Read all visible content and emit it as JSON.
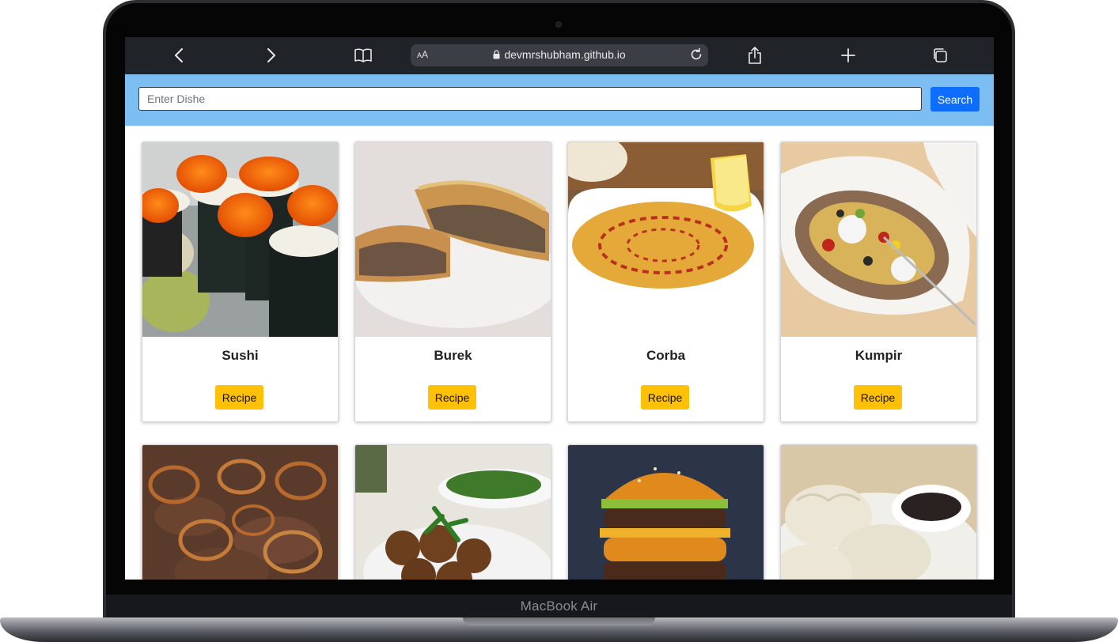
{
  "device": {
    "label": "MacBook Air"
  },
  "browser": {
    "url": "devmrshubham.github.io",
    "text_size_label": "AA"
  },
  "search": {
    "placeholder": "Enter Dishe",
    "value": "",
    "button_label": "Search"
  },
  "dishes": [
    {
      "name": "Sushi",
      "button": "Recipe"
    },
    {
      "name": "Burek",
      "button": "Recipe"
    },
    {
      "name": "Corba",
      "button": "Recipe"
    },
    {
      "name": "Kumpir",
      "button": "Recipe"
    }
  ],
  "colors": {
    "search_strip": "#7cbdf2",
    "search_button": "#0d6efd",
    "recipe_button": "#ffc107",
    "browser_bar": "#202328"
  }
}
